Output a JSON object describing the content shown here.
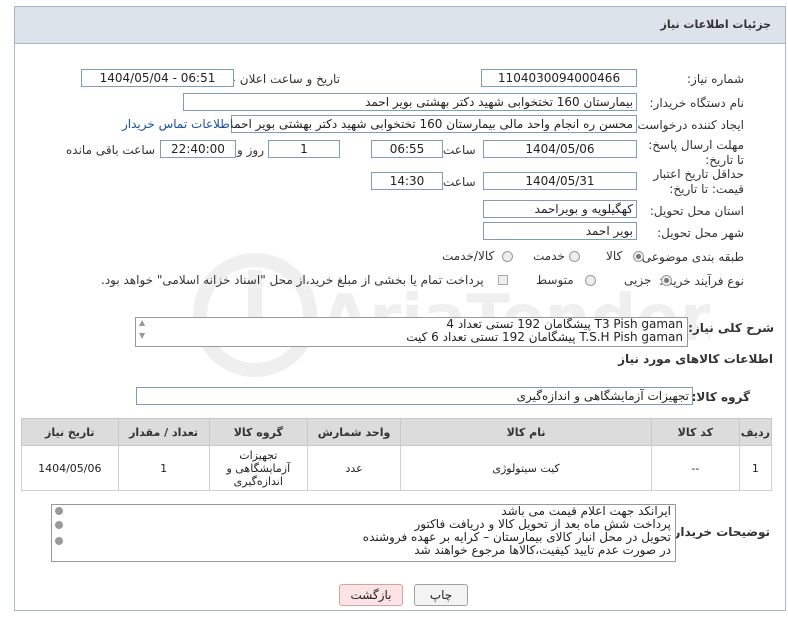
{
  "title": "جزئیات اطلاعات نیاز",
  "fields": {
    "need_number_label": "شماره نیاز:",
    "need_number": "1104030094000466",
    "announce_label": "تاریخ و ساعت اعلان عمومی:",
    "announce_value": "1404/05/04 - 06:51",
    "buyer_label": "نام دستگاه خریدار:",
    "buyer_value": "بیمارستان 160 تختخوابی شهید دکتر بهشتی بویر احمد",
    "creator_label": "ایجاد کننده درخواست:",
    "creator_value": "محسن ره انجام واحد مالی بیمارستان 160 تختخوابی شهید دکتر بهشتی بویر احمد",
    "contact_link": "اطلاعات تماس خریدار",
    "deadline_label": "مهلت ارسال پاسخ: تا تاریخ:",
    "deadline_date": "1404/05/06",
    "hour_label": "ساعت",
    "deadline_time": "06:55",
    "days_value": "1",
    "days_label": "روز و",
    "remaining_value": "22:40:00",
    "remaining_label": "ساعت باقی مانده",
    "validity_label": "حداقل تاریخ اعتبار قیمت: تا تاریخ:",
    "validity_date": "1404/05/31",
    "validity_time": "14:30",
    "province_label": "استان محل تحویل:",
    "province_value": "کهگیلویه و بویراحمد",
    "city_label": "شهر محل تحویل:",
    "city_value": "بویر احمد",
    "category_label": "طبقه بندی موضوعی:",
    "category_options": [
      "کالا",
      "خدمت",
      "کالا/خدمت"
    ],
    "category_selected": "کالا",
    "process_label": "نوع فرآیند خرید :",
    "process_options": [
      "جزیی",
      "متوسط"
    ],
    "process_selected": "جزیی",
    "process_note": "پرداخت تمام یا بخشی از مبلغ خرید،از محل \"اسناد خزانه اسلامی\" خواهد بود."
  },
  "summary": {
    "label": "شرح کلی نیاز:",
    "lines": [
      "T3 Pish gaman پیشگامان 192 تستی تعداد 4",
      "T.S.H Pish gaman پیشگامان 192 تستی تعداد 6 کیت"
    ]
  },
  "goods": {
    "section_title": "اطلاعات کالاهای مورد نیاز",
    "group_label": "گروه کالا:",
    "group_value": "تجهیزات آزمایشگاهی و اندازه‌گیری",
    "columns": [
      "ردیف",
      "کد کالا",
      "نام کالا",
      "واحد شمارش",
      "گروه کالا",
      "تعداد / مقدار",
      "تاریخ نیاز"
    ],
    "rows": [
      {
        "row": "1",
        "code": "--",
        "name": "کیت سیتولوژی",
        "unit": "عدد",
        "group": "تجهیزات آزمایشگاهی و اندازه‌گیری",
        "qty": "1",
        "date": "1404/05/06"
      }
    ]
  },
  "notes": {
    "label": "توضیحات خریدار:",
    "lines": [
      "ایرانکد جهت اعلام قیمت می باشد",
      "پرداخت شش ماه بعد از تحویل کالا و دریافت فاکتور",
      "تحویل در محل انبار کالای بیمارستان – کرایه بر عهده فروشنده",
      "در صورت عدم تایید کیفیت،کالاها مرجوع خواهند شد"
    ]
  },
  "buttons": {
    "print": "چاپ",
    "back": "بازگشت"
  },
  "colors": {
    "header_bg": "#dde3ea",
    "back_button_bg": "#fde3e3",
    "link": "#1a4fa0"
  },
  "watermark_text": "AriaTender.neT"
}
